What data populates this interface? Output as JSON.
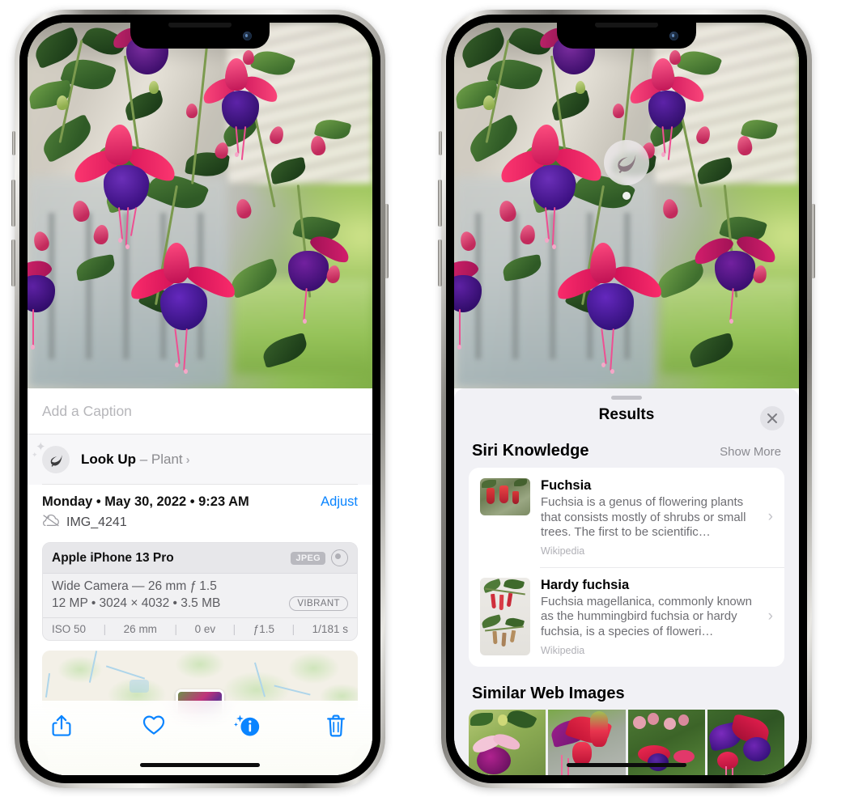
{
  "left_phone": {
    "photo": {
      "alt": "fuchsia-flowers-photo"
    },
    "caption": {
      "placeholder": "Add a Caption",
      "value": ""
    },
    "lookup": {
      "icon": "leaf-icon",
      "label_bold": "Look Up",
      "separator": " – ",
      "label_subject": "Plant",
      "chevron": "›"
    },
    "metadata": {
      "date_line": "Monday • May 30, 2022 • 9:23 AM",
      "adjust_label": "Adjust",
      "cloud_icon": "icloud-slash-icon",
      "filename": "IMG_4241"
    },
    "camera_card": {
      "model": "Apple iPhone 13 Pro",
      "format_badge": "JPEG",
      "aperture_icon": "aperture-icon",
      "lens_line": "Wide Camera — 26 mm ƒ 1.5",
      "size_line": "12 MP • 3024 × 4032 • 3.5 MB",
      "style_badge": "VIBRANT",
      "exif": [
        "ISO 50",
        "26 mm",
        "0 ev",
        "ƒ1.5",
        "1/181 s"
      ],
      "exif_divider": "|"
    },
    "map": {
      "label": "photo-location-map",
      "pin": "photo-thumbnail-pin"
    },
    "toolbar": {
      "share": "share-icon",
      "favorite": "heart-icon",
      "info": "info-visual-lookup-icon",
      "delete": "trash-icon"
    },
    "home_indicator": "home-indicator"
  },
  "right_phone": {
    "photo": {
      "alt": "fuchsia-flowers-photo"
    },
    "leaf_badge": {
      "icon": "leaf-icon",
      "label": "visual-look-up-leaf-badge"
    },
    "sheet": {
      "grabber": "sheet-grabber",
      "title": "Results",
      "close": "✕"
    },
    "siri_knowledge": {
      "section_title": "Siri Knowledge",
      "show_more": "Show More",
      "items": [
        {
          "title": "Fuchsia",
          "description": "Fuchsia is a genus of flowering plants that consists mostly of shrubs or small trees. The first to be scientific…",
          "source": "Wikipedia",
          "chevron": "›"
        },
        {
          "title": "Hardy fuchsia",
          "description": "Fuchsia magellanica, commonly known as the hummingbird fuchsia or hardy fuchsia, is a species of floweri…",
          "source": "Wikipedia",
          "chevron": "›"
        }
      ]
    },
    "similar_web_images": {
      "section_title": "Similar Web Images",
      "thumbnails": [
        "fuchsia-web-image-1",
        "fuchsia-web-image-2",
        "fuchsia-web-image-3",
        "fuchsia-web-image-4"
      ]
    },
    "home_indicator": "home-indicator"
  },
  "colors": {
    "accent_blue": "#0a84ff",
    "sheet_bg": "#f1f1f5",
    "card_bg": "#ffffff",
    "secondary_text": "#6e6e73",
    "tertiary_text": "#b0b0b6",
    "badge_gray": "#b9b9bf"
  }
}
